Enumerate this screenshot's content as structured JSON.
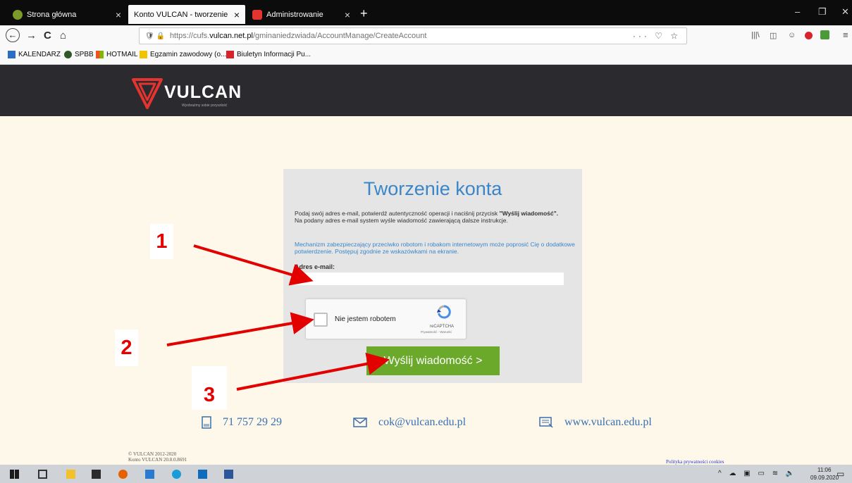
{
  "browser": {
    "tabs": [
      {
        "label": "Strona główna",
        "close": "×",
        "favicon_color": "#7a9a2a"
      },
      {
        "label": "Konto VULCAN - tworzenie konta",
        "close": "×",
        "favicon_color": "#e3342f"
      },
      {
        "label": "Administrowanie",
        "close": "×",
        "favicon_color": "#e3342f"
      }
    ],
    "new_tab": "+",
    "window_controls": {
      "minimize": "–",
      "restore": "❐",
      "close": "✕"
    },
    "nav": {
      "back": "←",
      "forward": "→",
      "reload": "C",
      "home": "⌂"
    },
    "url": {
      "prefix": "https://cufs.",
      "domain": "vulcan.net.pl",
      "path": "/gminaniedzwiada/AccountManage/CreateAccount",
      "page_actions": "··· ♡ ☆"
    },
    "toolbar_icons": [
      "library-icon",
      "sidebar-icon",
      "account-icon",
      "extension-icon",
      "extension-icon",
      "menu-icon"
    ],
    "bookmarks": [
      {
        "label": "KALENDARZ",
        "icon_color": "#2b6cc4"
      },
      {
        "label": "SPBB",
        "icon_color": "#2e5a27"
      },
      {
        "label": "HOTMAIL",
        "icon_color": "#f25022"
      },
      {
        "label": "Egzamin zawodowy (o...",
        "icon_color": "#f4c300"
      },
      {
        "label": "Biuletyn Informacji Pu...",
        "icon_color": "#d8232a"
      }
    ]
  },
  "site": {
    "logo_text": "VULCAN",
    "tagline": "Wyobraźmy sobie przyszłość",
    "brand_color": "#e3342f"
  },
  "form": {
    "title": "Tworzenie konta",
    "intro_part1": "Podaj swój adres e-mail, potwierdź autentyczność operacji i naciśnij przycisk ",
    "intro_bold": "\"Wyślij wiadomość\".",
    "intro_part2": "Na podany adres e-mail system wyśle wiadomość zawierającą dalsze instrukcje.",
    "captcha_notice": "Mechanizm zabezpieczający przeciwko robotom i robakom internetowym może poprosić Cię o dodatkowe potwierdzenie. Postępuj zgodnie ze wskazówkami na ekranie.",
    "email_label": "Adres e-mail:",
    "email_value": "",
    "captcha_label": "Nie jestem robotem",
    "captcha_brand": "reCAPTCHA",
    "captcha_links": "Prywatność - Warunki",
    "submit_label": "Wyślij wiadomość >",
    "accent_color": "#3a86c9",
    "button_color": "#6aa92a"
  },
  "annotations": [
    {
      "label": "1"
    },
    {
      "label": "2"
    },
    {
      "label": "3"
    }
  ],
  "contact": {
    "phone": "71 757 29 29",
    "email": "cok@vulcan.edu.pl",
    "website": "www.vulcan.edu.pl"
  },
  "footer": {
    "copyright": "© VULCAN 2012-2020",
    "version": "Konto VULCAN 20.8.0.8691",
    "cookies_link": "Polityka prywatności cookies"
  },
  "taskbar": {
    "apps": [
      "windows-start-icon",
      "task-view-icon",
      "file-explorer-icon",
      "store-icon",
      "firefox-icon",
      "photos-icon",
      "edge-icon",
      "mail-icon",
      "word-icon"
    ],
    "tray": "^ ☁ ▣ ▭ ≋ 🔈",
    "time": "11:06",
    "date": "09.09.2020"
  }
}
